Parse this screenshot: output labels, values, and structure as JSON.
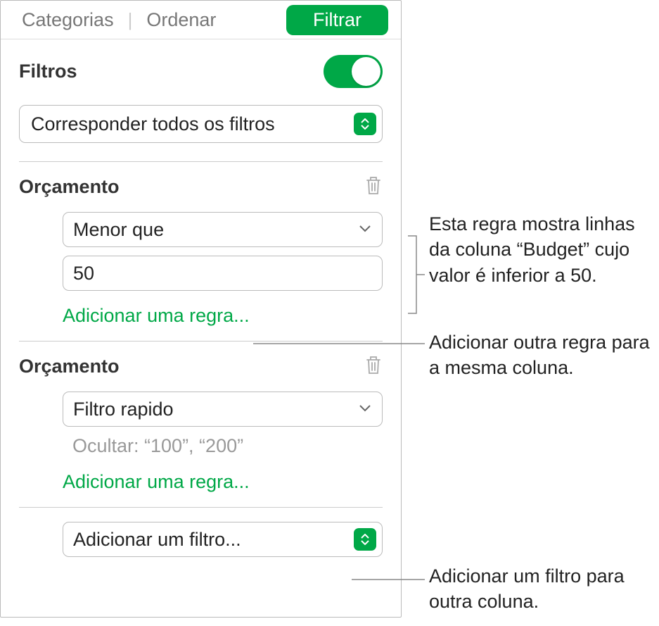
{
  "tabs": {
    "categorias": "Categorias",
    "ordenar": "Ordenar",
    "filtrar": "Filtrar"
  },
  "filters": {
    "title": "Filtros",
    "match_label": "Corresponder todos os filtros"
  },
  "group1": {
    "title": "Orçamento",
    "condition": "Menor que",
    "value": "50",
    "add_rule": "Adicionar uma regra..."
  },
  "group2": {
    "title": "Orçamento",
    "condition": "Filtro rapido",
    "hide_label": "Ocultar: “100”, “200”",
    "add_rule": "Adicionar uma regra..."
  },
  "add_filter": "Adicionar um filtro...",
  "annotations": {
    "a1": "Esta regra mostra linhas da coluna “Budget” cujo valor é inferior a 50.",
    "a2": "Adicionar outra regra para a mesma coluna.",
    "a3": "Adicionar um filtro para outra coluna."
  }
}
